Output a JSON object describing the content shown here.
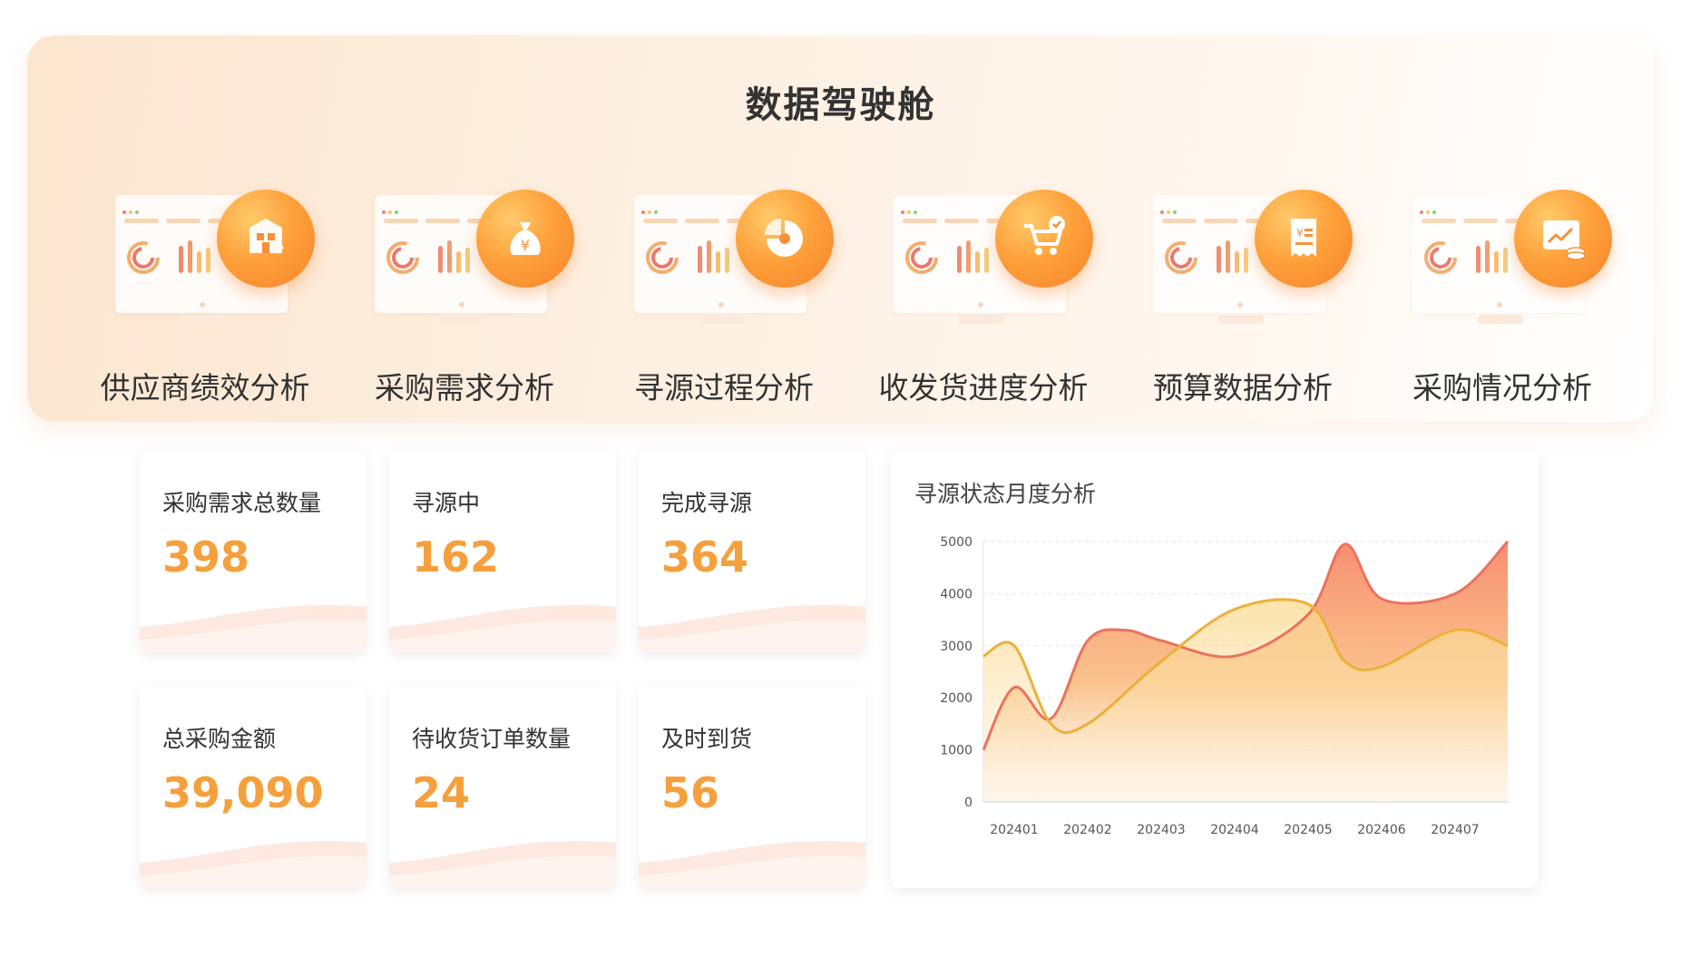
{
  "cockpit": {
    "title": "数据驾驶舱",
    "modules": [
      {
        "label": "供应商绩效分析",
        "icon": "building-box-icon"
      },
      {
        "label": "采购需求分析",
        "icon": "money-bag-icon"
      },
      {
        "label": "寻源过程分析",
        "icon": "pie-chart-icon"
      },
      {
        "label": "收发货进度分析",
        "icon": "cart-check-icon"
      },
      {
        "label": "预算数据分析",
        "icon": "receipt-icon"
      },
      {
        "label": "采购情况分析",
        "icon": "chart-coins-icon"
      }
    ]
  },
  "stats": [
    {
      "title": "采购需求总数量",
      "value": "398"
    },
    {
      "title": "寻源中",
      "value": "162"
    },
    {
      "title": "完成寻源",
      "value": "364"
    },
    {
      "title": "总采购金额",
      "value": "39,090"
    },
    {
      "title": "待收货订单数量",
      "value": "24"
    },
    {
      "title": "及时到货",
      "value": "56"
    }
  ],
  "chart": {
    "title": "寻源状态月度分析"
  },
  "chart_data": {
    "type": "area",
    "title": "寻源状态月度分析",
    "xlabel": "",
    "ylabel": "",
    "x": [
      "202401",
      "202402",
      "202403",
      "202404",
      "202405",
      "202406",
      "202407"
    ],
    "ylim": [
      0,
      5000
    ],
    "yticks": [
      0,
      1000,
      2000,
      3000,
      4000,
      5000
    ],
    "grid": true,
    "smooth": true,
    "series": [
      {
        "color": "#e9735f",
        "fill": "#f5a051",
        "points": [
          [
            "start",
            1000
          ],
          [
            "202401",
            2200
          ],
          [
            ">",
            1600
          ],
          [
            "202402",
            3100
          ],
          [
            ">",
            3300
          ],
          [
            "202403",
            3100
          ],
          [
            "202404",
            2800
          ],
          [
            "202405",
            3600
          ],
          [
            ">",
            4950
          ],
          [
            "202406",
            3900
          ],
          [
            "202407",
            4000
          ],
          [
            "end",
            5000
          ]
        ]
      },
      {
        "color": "#eab13a",
        "fill": "#fbe3b0",
        "points": [
          [
            "start",
            2800
          ],
          [
            "202401",
            3000
          ],
          [
            ">",
            1500
          ],
          [
            "202402",
            1500
          ],
          [
            "202403",
            2700
          ],
          [
            "202404",
            3700
          ],
          [
            "202405",
            3800
          ],
          [
            ">",
            2700
          ],
          [
            "202406",
            2600
          ],
          [
            "202407",
            3300
          ],
          [
            "end",
            3000
          ]
        ]
      }
    ]
  }
}
